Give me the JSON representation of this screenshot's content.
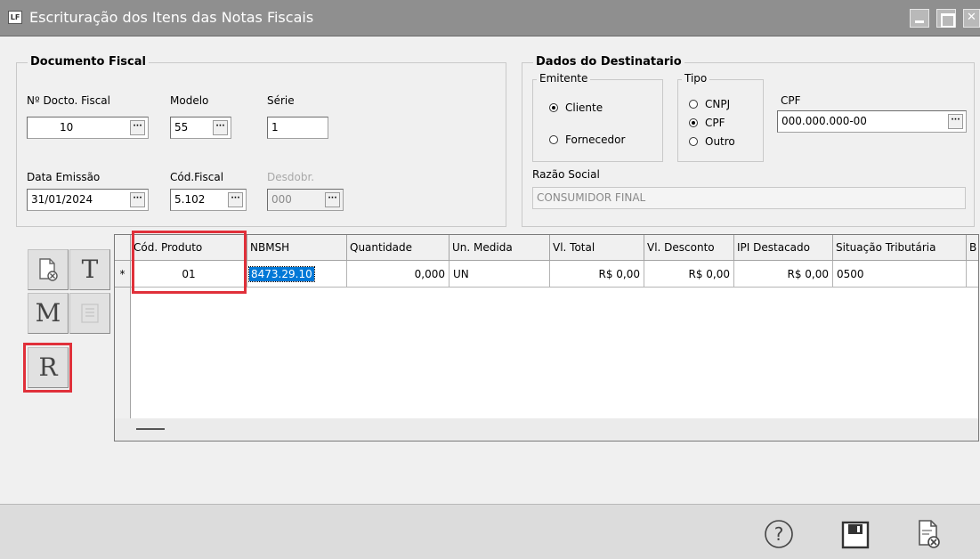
{
  "window": {
    "title": "Escrituração dos Itens das Notas Fiscais",
    "icon_text": "LF"
  },
  "documento": {
    "legend": "Documento Fiscal",
    "nr_label": "Nº Docto. Fiscal",
    "nr_value": "10",
    "modelo_label": "Modelo",
    "modelo_value": "55",
    "serie_label": "Série",
    "serie_value": "1",
    "data_label": "Data Emissão",
    "data_value": "31/01/2024",
    "cfop_label": "Cód.Fiscal",
    "cfop_value": "5.102",
    "desdobr_label": "Desdobr.",
    "desdobr_value": "000"
  },
  "destinatario": {
    "legend": "Dados do Destinatario",
    "emitente_legend": "Emitente",
    "emitente_options": [
      "Cliente",
      "Fornecedor"
    ],
    "emitente_selected": "Cliente",
    "tipo_legend": "Tipo",
    "tipo_options": [
      "CNPJ",
      "CPF",
      "Outro"
    ],
    "tipo_selected": "CPF",
    "cpf_label": "CPF",
    "cpf_value": "000.000.000-00",
    "razao_label": "Razão Social",
    "razao_value": "CONSUMIDOR FINAL"
  },
  "tools": {
    "t_label": "T",
    "m_label": "M",
    "r_label": "R"
  },
  "grid": {
    "columns": [
      "Cód. Produto",
      "NBMSH",
      "Quantidade",
      "Un. Medida",
      "Vl. Total",
      "Vl. Desconto",
      "IPI Destacado",
      "Situação Tributária",
      "B"
    ],
    "row_indicator": "*",
    "rows": [
      [
        "01",
        "8473.29.10",
        "0,000",
        "UN",
        "R$ 0,00",
        "R$ 0,00",
        "R$ 0,00",
        "0500",
        ""
      ]
    ]
  },
  "footer": {
    "help_label": "?"
  },
  "colors": {
    "highlight": "#e0303a",
    "selection": "#0078d7",
    "titlebar": "#8f8f8f"
  }
}
